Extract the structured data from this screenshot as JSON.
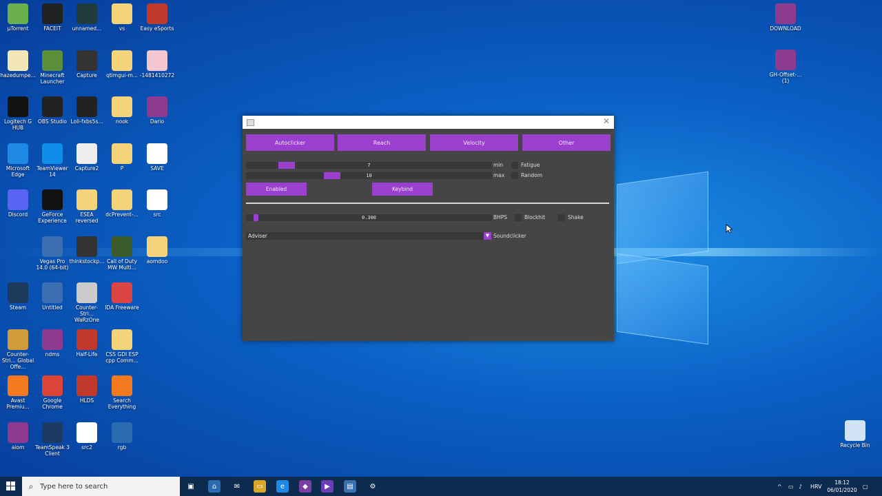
{
  "desktop": {
    "icons_col1": [
      {
        "label": "µTorrent",
        "icon": "utorrent-icon",
        "color": "#6ab04c"
      },
      {
        "label": "hazedumpe...",
        "icon": "document-icon",
        "color": "#f3e7b5"
      },
      {
        "label": "Logitech G HUB",
        "icon": "logitech-icon",
        "color": "#111111"
      },
      {
        "label": "Microsoft Edge",
        "icon": "edge-icon",
        "color": "#1e88e5"
      },
      {
        "label": "Discord",
        "icon": "discord-icon",
        "color": "#5865f2"
      },
      {
        "label": "",
        "icon": "blank-icon",
        "color": "transparent"
      },
      {
        "label": "Steam",
        "icon": "steam-icon",
        "color": "#1b3a5c"
      },
      {
        "label": "Counter-Stri... Global Offe...",
        "icon": "csgo-icon",
        "color": "#d19a3b"
      },
      {
        "label": "Avast Premiu...",
        "icon": "avast-icon",
        "color": "#f47a20"
      },
      {
        "label": "aiom",
        "icon": "winrar-icon",
        "color": "#8e3b8f"
      }
    ],
    "icons_col2": [
      {
        "label": "FACEIT",
        "icon": "faceit-icon",
        "color": "#222222"
      },
      {
        "label": "Minecraft Launcher",
        "icon": "minecraft-icon",
        "color": "#5b8f3a"
      },
      {
        "label": "OBS Studio",
        "icon": "obs-icon",
        "color": "#222222"
      },
      {
        "label": "TeamViewer 14",
        "icon": "teamviewer-icon",
        "color": "#0e8ee9"
      },
      {
        "label": "GeForce Experience",
        "icon": "nvidia-icon",
        "color": "#111111"
      },
      {
        "label": "Vegas Pro 14.0 (64-bit)",
        "icon": "vegas-icon",
        "color": "#3b6fb0"
      },
      {
        "label": "Untitled",
        "icon": "vegas-project-icon",
        "color": "#3b6fb0"
      },
      {
        "label": "ndms",
        "icon": "winrar-icon",
        "color": "#8e3b8f"
      },
      {
        "label": "Google Chrome",
        "icon": "chrome-icon",
        "color": "#db4437"
      },
      {
        "label": "TeamSpeak 3 Client",
        "icon": "teamspeak-icon",
        "color": "#1c3b63"
      }
    ],
    "icons_col3": [
      {
        "label": "unnamed...",
        "icon": "unnamed-icon",
        "color": "#1f3b3b"
      },
      {
        "label": "Capture",
        "icon": "capture-icon",
        "color": "#333333"
      },
      {
        "label": "Loli-fxbs5s...",
        "icon": "file-icon",
        "color": "#222222"
      },
      {
        "label": "Capture2",
        "icon": "image-icon",
        "color": "#eeeeee"
      },
      {
        "label": "ESEA reversed",
        "icon": "folder-icon",
        "color": "#f4d37a"
      },
      {
        "label": "thinkstockp...",
        "icon": "image-icon",
        "color": "#333333"
      },
      {
        "label": "Counter-Stri... WaRzOne",
        "icon": "cs-icon",
        "color": "#cccccc"
      },
      {
        "label": "Half-Life",
        "icon": "halflife-icon",
        "color": "#c0392b"
      },
      {
        "label": "HLDS",
        "icon": "hlds-icon",
        "color": "#c0392b"
      },
      {
        "label": "src2",
        "icon": "text-file-icon",
        "color": "#ffffff"
      }
    ],
    "icons_col4": [
      {
        "label": "vs",
        "icon": "folder-icon",
        "color": "#f4d37a"
      },
      {
        "label": "qtimgui-m...",
        "icon": "folder-icon",
        "color": "#f4d37a"
      },
      {
        "label": "nook",
        "icon": "folder-icon",
        "color": "#f4d37a"
      },
      {
        "label": "P",
        "icon": "folder-icon",
        "color": "#f4d37a"
      },
      {
        "label": "dcPrevent-...",
        "icon": "folder-icon",
        "color": "#f4d37a"
      },
      {
        "label": "Call of Duty MW Multi...",
        "icon": "cod-icon",
        "color": "#3b5b2b"
      },
      {
        "label": "IDA Freeware",
        "icon": "ida-icon",
        "color": "#d44"
      },
      {
        "label": "CSS GDI ESP cpp Comm...",
        "icon": "cpp-icon",
        "color": "#f4d37a"
      },
      {
        "label": "Search Everything",
        "icon": "search-everything-icon",
        "color": "#f47a20"
      },
      {
        "label": "rgb",
        "icon": "winrar-icon",
        "color": "#2b6cb0"
      }
    ],
    "icons_col5": [
      {
        "label": "Easy eSports",
        "icon": "easy-esports-icon",
        "color": "#c0392b"
      },
      {
        "label": "-1481410272",
        "icon": "anime-image-icon",
        "color": "#f5c5d0"
      },
      {
        "label": "Dario",
        "icon": "winrar-icon",
        "color": "#8e3b8f"
      },
      {
        "label": "SAVE",
        "icon": "text-file-icon",
        "color": "#ffffff"
      },
      {
        "label": "src",
        "icon": "text-file-icon",
        "color": "#ffffff"
      },
      {
        "label": "aomdoo",
        "icon": "cpp-icon",
        "color": "#f4d37a"
      }
    ],
    "icons_right": [
      {
        "label": "DOWNLOAD",
        "icon": "winrar-icon",
        "color": "#8e3b8f"
      },
      {
        "label": "GH-Offset-... (1)",
        "icon": "winrar-icon",
        "color": "#8e3b8f"
      },
      {
        "label": "Recycle Bin",
        "icon": "recycle-bin-icon",
        "color": "#d0e4f5"
      }
    ]
  },
  "app": {
    "tabs": [
      "Autoclicker",
      "Reach",
      "Velocity",
      "Other"
    ],
    "slider_min_value": "7",
    "slider_min_fraction": 0.14,
    "slider_min_label": "min",
    "slider_max_value": "10",
    "slider_max_fraction": 0.34,
    "slider_max_label": "max",
    "fatigue_label": "Fatigue",
    "random_label": "Random",
    "enabled_button": "Enabled",
    "keybind_button": "Keybind",
    "bhps_value": "0.300",
    "bhps_fraction": 0.03,
    "bhps_label": "BHPS",
    "blockhit_label": "Blockhit",
    "shake_label": "Shake",
    "combo_value": "Adviser",
    "soundclicker_label": "Soundclicker",
    "accent_color": "#9b3fcf"
  },
  "taskbar": {
    "search_placeholder": "Type here to search",
    "language": "HRV",
    "time": "18:12",
    "date": "06/01/2020"
  }
}
